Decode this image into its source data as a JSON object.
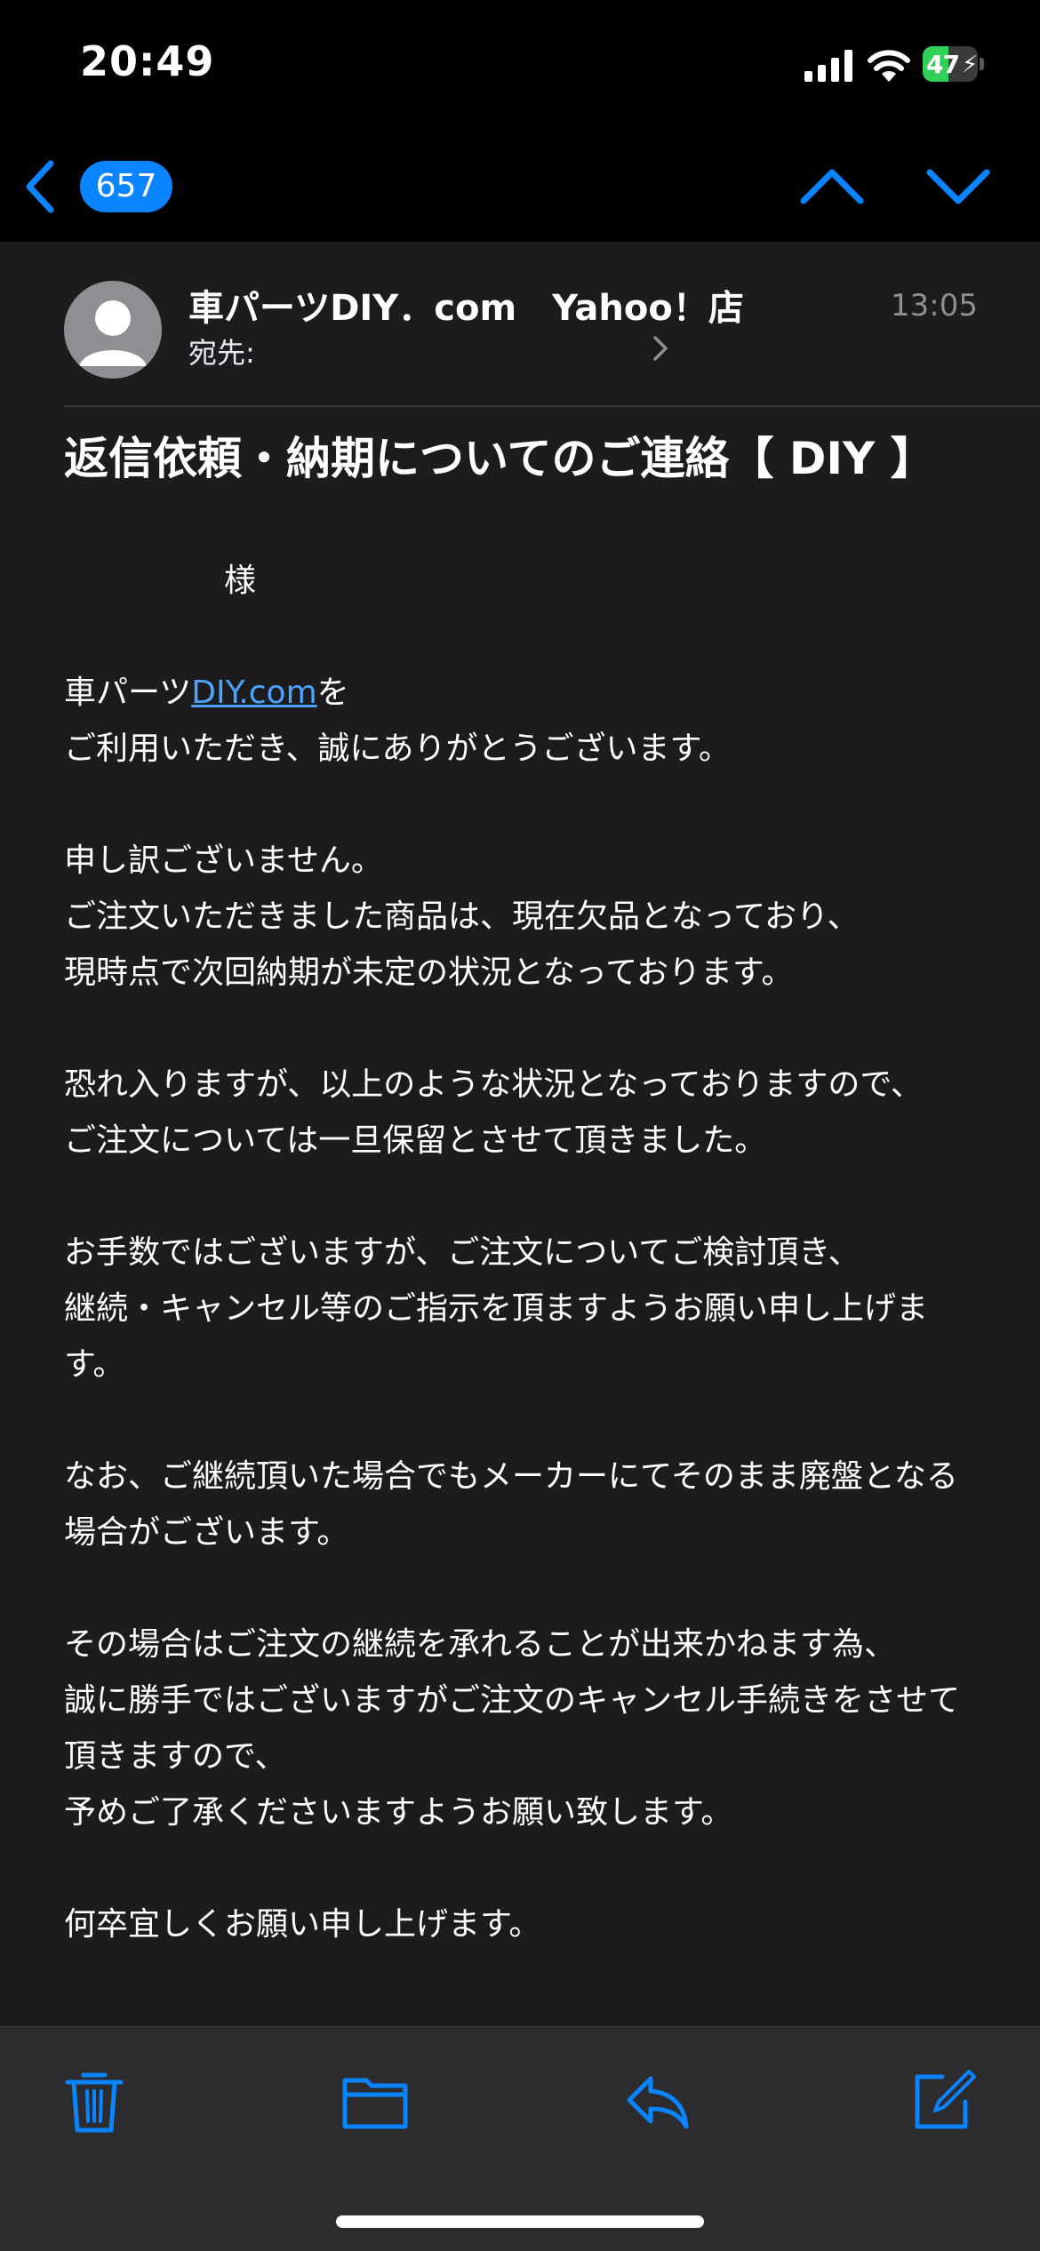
{
  "status_bar": {
    "time": "20:49",
    "battery_level": "47",
    "battery_charging": true,
    "battery_fill_fraction": 0.47
  },
  "nav": {
    "back_icon": "chevron-left-icon",
    "unread_count": "657",
    "previous_icon": "chevron-up-icon",
    "next_icon": "chevron-down-icon"
  },
  "message": {
    "sender": "車パーツDIY．com　Yahoo！店",
    "to_label": "宛先:",
    "time": "13:05",
    "subject": "返信依頼・納期についてのご連絡【 DIY 】",
    "salutation": "様",
    "paragraphs": [
      {
        "line1_prefix": "車パーツ",
        "line1_link": "DIY.com",
        "line1_suffix": "を",
        "line2": "ご利用いただき、誠にありがとうございます。"
      },
      [
        "申し訳ございません。",
        "ご注文いただきました商品は、現在欠品となっており、",
        "現時点で次回納期が未定の状況となっております。"
      ],
      [
        "恐れ入りますが、以上のような状況となっておりますので、",
        "ご注文については一旦保留とさせて頂きました。"
      ],
      [
        "お手数ではございますが、ご注文についてご検討頂き、",
        "継続・キャンセル等のご指示を頂ますようお願い申し上げます。"
      ],
      [
        "なお、ご継続頂いた場合でもメーカーにてそのまま廃盤となる場合がございます。"
      ],
      [
        "その場合はご注文の継続を承れることが出来かねます為、",
        "誠に勝手ではございますがご注文のキャンセル手続きをさせて頂きますので、",
        "予めご了承くださいますようお願い致します。"
      ],
      [
        "何卒宜しくお願い申し上げます。"
      ]
    ]
  },
  "toolbar": {
    "items": [
      "trash-icon",
      "folder-icon",
      "reply-icon",
      "compose-icon"
    ]
  },
  "colors": {
    "accent": "#0a84ff",
    "background": "#1c1c1e",
    "bars": "#000000",
    "toolbar": "#2c2c2e",
    "link": "#4da3ff",
    "secondary_text": "#8e8e93"
  }
}
